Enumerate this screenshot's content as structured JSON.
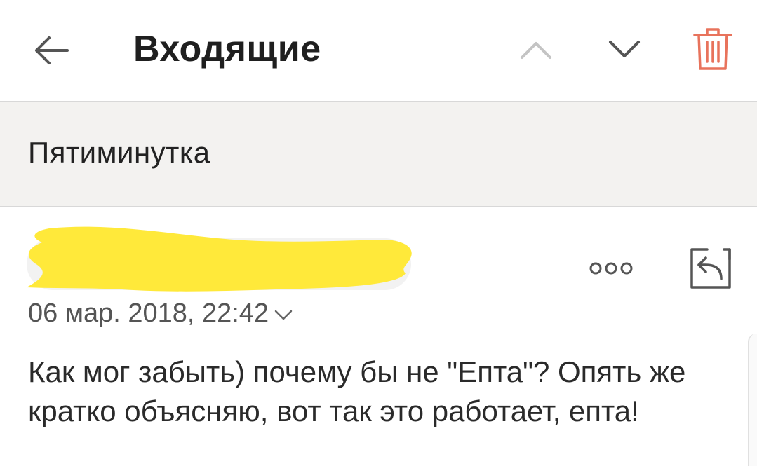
{
  "header": {
    "title": "Входящие",
    "back_icon": "arrow-left-icon",
    "prev_icon": "chevron-up-icon",
    "next_icon": "chevron-down-icon",
    "delete_icon": "trash-icon"
  },
  "message": {
    "subject": "Пятиминутка",
    "sender_name": "",
    "date": "06 мар. 2018, 22:42",
    "body": "Как мог забыть) почему бы не \"Епта\"? Опять же кратко объясняю, вот так это работает, епта!"
  },
  "actions": {
    "more_icon": "more-dots-icon",
    "reply_icon": "reply-icon"
  },
  "colors": {
    "accent_delete": "#e8735c",
    "subject_band": "#f3f2f0",
    "redaction": "#ffe93a"
  }
}
